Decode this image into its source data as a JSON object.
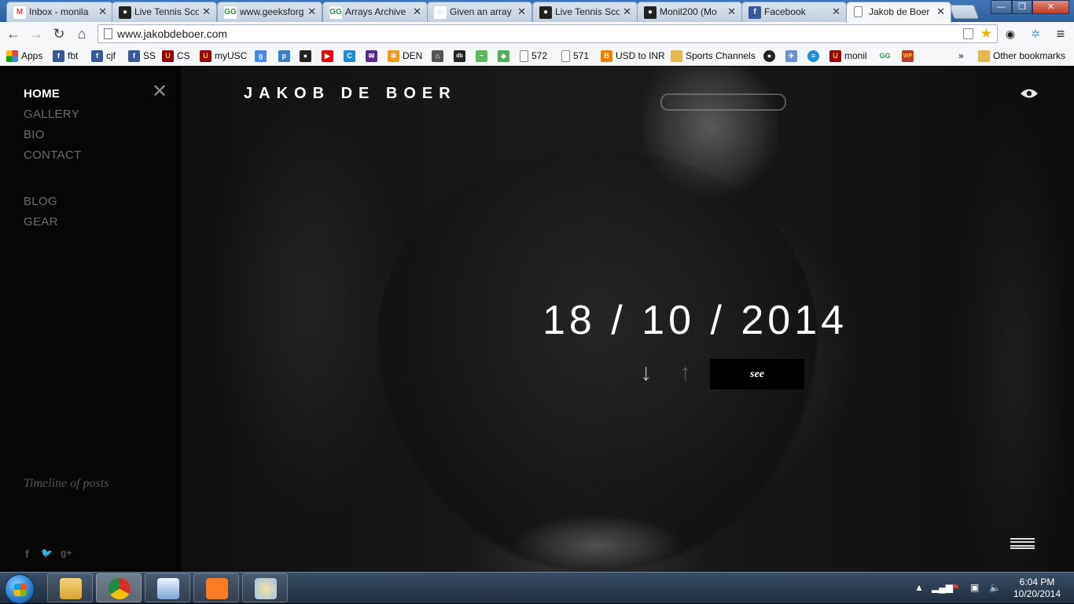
{
  "browser": {
    "tabs": [
      {
        "label": "Inbox - monila",
        "icon": "gmail-icon"
      },
      {
        "label": "Live Tennis Sco",
        "icon": "generic-icon"
      },
      {
        "label": "www.geeksforg",
        "icon": "geeksforgeeks-icon"
      },
      {
        "label": "Arrays Archive",
        "icon": "geeksforgeeks-icon"
      },
      {
        "label": "Given an array",
        "icon": "spinner-icon"
      },
      {
        "label": "Live Tennis Sco",
        "icon": "generic-icon"
      },
      {
        "label": "Monil200 (Mo",
        "icon": "github-icon"
      },
      {
        "label": "Facebook",
        "icon": "facebook-icon"
      },
      {
        "label": "Jakob de Boer",
        "icon": "page-icon"
      }
    ],
    "tab_close": "✕",
    "url": "www.jakobdeboer.com",
    "bookmarks": [
      {
        "label": "Apps",
        "icon": "apps-grid-icon",
        "color": "#d44"
      },
      {
        "label": "fbt",
        "icon": "facebook-icon",
        "color": "#3b5998"
      },
      {
        "label": "cjf",
        "icon": "facebook-icon",
        "color": "#3b5998"
      },
      {
        "label": "SS",
        "icon": "facebook-icon",
        "color": "#3b5998"
      },
      {
        "label": "CS",
        "icon": "usc-icon",
        "color": "#990000"
      },
      {
        "label": "myUSC",
        "icon": "usc-icon",
        "color": "#990000"
      },
      {
        "label": "",
        "icon": "google-icon",
        "color": "#4285f4"
      },
      {
        "label": "",
        "icon": "p-icon",
        "color": "#3b7ec2"
      },
      {
        "label": "",
        "icon": "generic-icon",
        "color": "#222"
      },
      {
        "label": "",
        "icon": "youtube-icon",
        "color": "#e00"
      },
      {
        "label": "",
        "icon": "c-icon",
        "color": "#1f8ad6"
      },
      {
        "label": "",
        "icon": "mail-icon",
        "color": "#5a2a8a"
      },
      {
        "label": "DEN",
        "icon": "den-icon",
        "color": "#f39c12"
      },
      {
        "label": "",
        "icon": "bank-icon",
        "color": "#555"
      },
      {
        "label": "",
        "icon": "imdb-icon",
        "color": "#222"
      },
      {
        "label": "",
        "icon": "green-icon",
        "color": "#5cb85c"
      },
      {
        "label": "",
        "icon": "maps-icon",
        "color": "#4caf50"
      },
      {
        "label": "572",
        "icon": "page-icon",
        "color": "#fff"
      },
      {
        "label": "571",
        "icon": "page-icon",
        "color": "#fff"
      },
      {
        "label": "USD to INR",
        "icon": "blogger-icon",
        "color": "#f57d00"
      },
      {
        "label": "Sports Channels",
        "icon": "folder-icon",
        "color": "#e6b84a"
      },
      {
        "label": "",
        "icon": "github-icon",
        "color": "#222"
      },
      {
        "label": "",
        "icon": "bird-icon",
        "color": "#6b8fd6"
      },
      {
        "label": "",
        "icon": "att-icon",
        "color": "#1b8fd9"
      },
      {
        "label": "monil",
        "icon": "usc-icon",
        "color": "#990000"
      },
      {
        "label": "",
        "icon": "geeksforgeeks-icon",
        "color": "#2f8d46"
      },
      {
        "label": "",
        "icon": "wp-icon",
        "color": "#c0392b"
      }
    ],
    "overflow": "»",
    "other_bookmarks": "Other bookmarks"
  },
  "site": {
    "brand": "JAKOB DE BOER",
    "nav": [
      {
        "label": "HOME",
        "active": true
      },
      {
        "label": "GALLERY",
        "active": false
      },
      {
        "label": "BIO",
        "active": false
      },
      {
        "label": "CONTACT",
        "active": false
      },
      {
        "label": "BLOG",
        "active": false
      },
      {
        "label": "GEAR",
        "active": false
      }
    ],
    "close_glyph": "✕",
    "timeline_link": "Timeline of posts",
    "social": {
      "facebook": "f",
      "twitter": "🐦",
      "google_plus": "g+"
    },
    "post_date": "18 / 10 / 2014",
    "arrow_down": "↓",
    "arrow_up": "↑",
    "see_label": "see"
  },
  "taskbar": {
    "apps": [
      {
        "name": "explorer",
        "icon": "folder-icon",
        "color": "#e6b84a"
      },
      {
        "name": "chrome",
        "icon": "chrome-icon",
        "color": "#d93025"
      },
      {
        "name": "notepad",
        "icon": "notepad-icon",
        "color": "#7aa7d6"
      },
      {
        "name": "xampp",
        "icon": "xampp-icon",
        "color": "#fb7a24"
      },
      {
        "name": "paint",
        "icon": "paint-icon",
        "color": "#9fc3e6"
      }
    ],
    "time": "6:04 PM",
    "date": "10/20/2014"
  }
}
